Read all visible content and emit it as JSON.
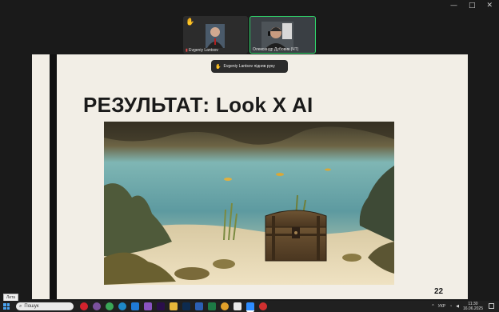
{
  "window_controls": [
    "—",
    "□",
    "✕"
  ],
  "participants": [
    {
      "name": "Evgeniy Lantsov",
      "raised_hand": true,
      "muted": true
    },
    {
      "name": "Олександр Дубовик (ЧТ)",
      "raised_hand": false,
      "muted": false
    }
  ],
  "toast": {
    "text": "Evgeniy Lantsov підняв руку"
  },
  "slide": {
    "title": "РЕЗУЛЬТАТ: Look X AI",
    "page_number": "22"
  },
  "small_label": "Лита",
  "taskbar": {
    "search_placeholder": "Пошук",
    "language": "УКР",
    "time": "11:30",
    "date": "16.06.2025"
  },
  "colors": {
    "active_border": "#2fd46a",
    "hand": "#f3c23a",
    "slide_bg": "#f2eee6"
  }
}
